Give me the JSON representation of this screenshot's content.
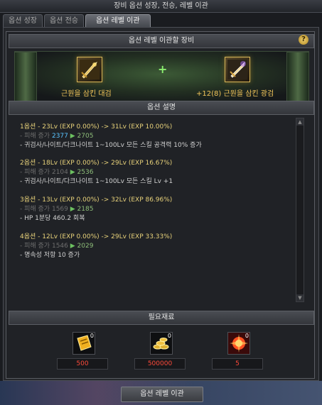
{
  "window": {
    "title": "장비 옵션 성장, 전승, 레벨 이관"
  },
  "tabs": [
    {
      "label": "옵션 성장"
    },
    {
      "label": "옵션 전승"
    },
    {
      "label": "옵션 레벨 이관"
    }
  ],
  "equip_section": {
    "header": "옵션 레벨 이관할 장비",
    "help_symbol": "?",
    "plus_symbol": "+",
    "source": {
      "name": "근원을 삼킨 대검",
      "icon": "greatsword-icon"
    },
    "target": {
      "name": "+12(8) 근원을 삼킨 광검",
      "icon": "lightsword-icon"
    }
  },
  "desc_section": {
    "header": "옵션 설명",
    "options": [
      {
        "title": "1옵션 - 23Lv (EXP 0.00%) -> 31Lv (EXP 10.00%)",
        "stat_label": "- 피해 증가",
        "stat_from": "2377",
        "arrow": "▶",
        "stat_to": "2705",
        "effect": "- 귀검사/나이트/다크나이트 1~100Lv 모든 스킬 공격력 10% 증가"
      },
      {
        "title": "2옵션 - 18Lv (EXP 0.00%) -> 29Lv (EXP 16.67%)",
        "stat_label": "- 피해 증가",
        "stat_from": "2104",
        "arrow": "▶",
        "stat_to": "2536",
        "effect": "- 귀검사/나이트/다크나이트 1~100Lv 모든 스킬 Lv +1"
      },
      {
        "title": "3옵션 - 13Lv (EXP 0.00%) -> 32Lv (EXP 86.96%)",
        "stat_label": "- 피해 증가",
        "stat_from": "1569",
        "arrow": "▶",
        "stat_to": "2185",
        "effect": "- HP 1분당 460.2 회복"
      },
      {
        "title": "4옵션 - 12Lv (EXP 0.00%) -> 29Lv (EXP 33.33%)",
        "stat_label": "- 피해 증가",
        "stat_from": "1546",
        "arrow": "▶",
        "stat_to": "2029",
        "effect": "- 명속성 저항 10 증가"
      }
    ]
  },
  "materials_section": {
    "header": "필요재료",
    "items": [
      {
        "icon": "gold-ticket-icon",
        "owned": "0",
        "required": "500"
      },
      {
        "icon": "gold-coins-icon",
        "owned": "0",
        "required": "500000"
      },
      {
        "icon": "burst-crystal-icon",
        "owned": "0",
        "required": "5"
      }
    ]
  },
  "action_button": {
    "label": "옵션 레벨 이관"
  }
}
